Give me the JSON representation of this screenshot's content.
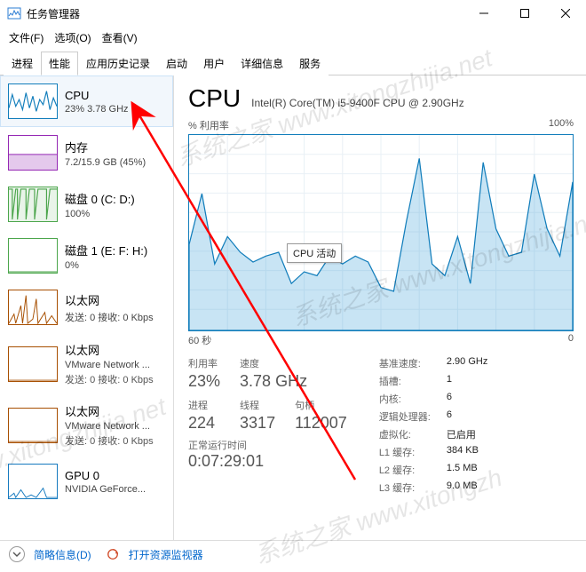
{
  "window": {
    "title": "任务管理器"
  },
  "menu": {
    "file": "文件(F)",
    "options": "选项(O)",
    "view": "查看(V)"
  },
  "tabs": [
    {
      "label": "进程"
    },
    {
      "label": "性能"
    },
    {
      "label": "应用历史记录"
    },
    {
      "label": "启动"
    },
    {
      "label": "用户"
    },
    {
      "label": "详细信息"
    },
    {
      "label": "服务"
    }
  ],
  "sidebar": [
    {
      "title": "CPU",
      "sub": "23% 3.78 GHz"
    },
    {
      "title": "内存",
      "sub": "7.2/15.9 GB (45%)"
    },
    {
      "title": "磁盘 0 (C: D:)",
      "sub": "100%"
    },
    {
      "title": "磁盘 1 (E: F: H:)",
      "sub": "0%"
    },
    {
      "title": "以太网",
      "sub": "发送: 0 接收: 0 Kbps"
    },
    {
      "title": "以太网",
      "sub": "VMware Network ...",
      "sub2": "发送: 0 接收: 0 Kbps"
    },
    {
      "title": "以太网",
      "sub": "VMware Network ...",
      "sub2": "发送: 0 接收: 0 Kbps"
    },
    {
      "title": "GPU 0",
      "sub": "NVIDIA GeForce..."
    }
  ],
  "detail": {
    "title": "CPU",
    "model": "Intel(R) Core(TM) i5-9400F CPU @ 2.90GHz",
    "chart_top_left": "% 利用率",
    "chart_top_right": "100%",
    "chart_bottom_left": "60 秒",
    "chart_bottom_right": "0",
    "tooltip": "CPU 活动",
    "labels": {
      "util": "利用率",
      "speed": "速度",
      "procs": "进程",
      "threads": "线程",
      "handles": "句柄",
      "uptime": "正常运行时间",
      "basespeed": "基准速度:",
      "sockets": "插槽:",
      "cores": "内核:",
      "logical": "逻辑处理器:",
      "virt": "虚拟化:",
      "l1": "L1 缓存:",
      "l2": "L2 缓存:",
      "l3": "L3 缓存:"
    },
    "values": {
      "util": "23%",
      "speed": "3.78 GHz",
      "procs": "224",
      "threads": "3317",
      "handles": "112007",
      "uptime": "0:07:29:01",
      "basespeed": "2.90 GHz",
      "sockets": "1",
      "cores": "6",
      "logical": "6",
      "virt": "已启用",
      "l1": "384 KB",
      "l2": "1.5 MB",
      "l3": "9.0 MB"
    }
  },
  "footer": {
    "less": "简略信息(D)",
    "resmon": "打开资源监视器"
  },
  "watermark": {
    "line1": "系统之家 www.xitongzhijia.net",
    "line2": "系统之家 www.xitongzhijia.net",
    "line3": "www.xitongzhijia.net",
    "line4": "系统之家 www.xitongzh"
  },
  "chart_data": {
    "type": "line",
    "title": "% 利用率",
    "xlabel": "60 秒",
    "ylabel": "",
    "ylim": [
      0,
      100
    ],
    "xlim": [
      60,
      0
    ],
    "x_seconds_ago": [
      60,
      58,
      56,
      54,
      52,
      50,
      48,
      46,
      44,
      42,
      40,
      38,
      36,
      34,
      32,
      30,
      28,
      26,
      24,
      22,
      20,
      18,
      16,
      14,
      12,
      10,
      8,
      6,
      4,
      2,
      0
    ],
    "utilization_pct": [
      44,
      70,
      34,
      48,
      40,
      35,
      38,
      40,
      24,
      30,
      28,
      38,
      34,
      38,
      35,
      22,
      20,
      56,
      88,
      34,
      28,
      48,
      24,
      86,
      52,
      38,
      40,
      80,
      52,
      38,
      76
    ]
  }
}
